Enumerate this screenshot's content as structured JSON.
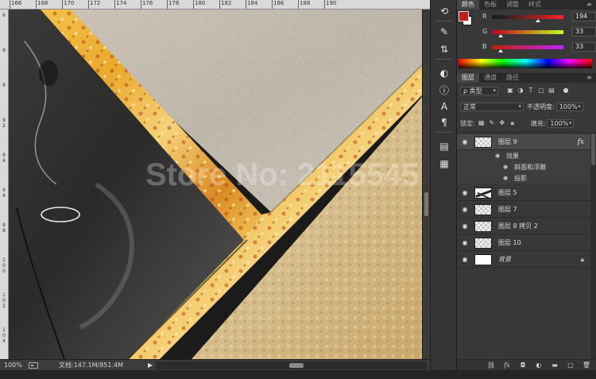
{
  "ruler": {
    "top_ticks": [
      "166",
      "168",
      "170",
      "172",
      "174",
      "176",
      "178",
      "180",
      "182",
      "184",
      "186",
      "188",
      "190"
    ],
    "left_ticks": [
      "6",
      "8",
      "9",
      "9\n2",
      "9\n4",
      "9\n6",
      "9\n8",
      "1\n0\n0",
      "1\n0\n2",
      "1\n0\n4"
    ]
  },
  "canvas": {
    "watermark": "Store No: 2115545"
  },
  "status": {
    "zoom": "100%",
    "doc_info": "文档:147.1M/851.4M",
    "play_icon": "play-arrow-icon"
  },
  "toolstrip": {
    "icons": [
      "history-icon",
      "brush-preset-icon",
      "clone-source-icon",
      "adjust-icon",
      "info-icon",
      "type-character-icon",
      "paragraph-icon",
      "layer-comps-icon",
      "notes-icon"
    ]
  },
  "color_panel": {
    "tabs": [
      "颜色",
      "色板",
      "调整",
      "样式"
    ],
    "active_tab": 0,
    "foreground": "#c21f21",
    "background": "#ffffff",
    "channels": [
      {
        "label": "R",
        "value": "194"
      },
      {
        "label": "G",
        "value": "33"
      },
      {
        "label": "B",
        "value": "33"
      }
    ]
  },
  "layers_panel": {
    "tabs": [
      "图层",
      "通道",
      "路径"
    ],
    "active_tab": 0,
    "filter_kind": "ρ 类型",
    "blend_mode": "正常",
    "opacity_label": "不透明度:",
    "opacity_value": "100%",
    "lock_label": "锁定:",
    "fill_label": "填充:",
    "fill_value": "100%",
    "layers": [
      {
        "name": "图层 9",
        "has_fx": true,
        "fx_label": "fx",
        "thumb": "checker"
      },
      {
        "name": "图层 5",
        "thumb": "art"
      },
      {
        "name": "图层 7",
        "thumb": "checker"
      },
      {
        "name": "图层 8 拷贝 2",
        "thumb": "checker"
      },
      {
        "name": "图层 10",
        "thumb": "checker"
      },
      {
        "name": "背景",
        "thumb": "white",
        "locked": true
      }
    ],
    "effects": {
      "header": "效果",
      "items": [
        "斜面和浮雕",
        "投影"
      ]
    }
  }
}
